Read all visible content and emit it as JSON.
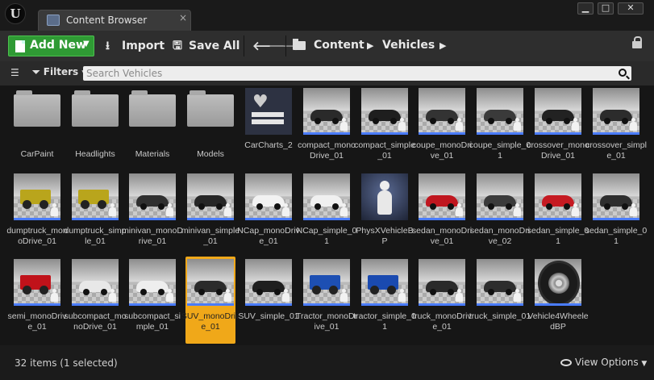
{
  "window": {
    "tab_title": "Content Browser",
    "tab_close": "×",
    "buttons": [
      "▁",
      "□",
      "✕"
    ]
  },
  "toolbar": {
    "add_new": "Add New",
    "import": "Import",
    "save_all": "Save All",
    "breadcrumb": [
      "Content",
      "Vehicles"
    ]
  },
  "search": {
    "filters": "Filters",
    "placeholder": "Search Vehicles"
  },
  "assets": [
    {
      "name": "CarPaint",
      "kind": "folder"
    },
    {
      "name": "Headlights",
      "kind": "folder"
    },
    {
      "name": "Materials",
      "kind": "folder"
    },
    {
      "name": "Models",
      "kind": "folder"
    },
    {
      "name": "CarCharts_2",
      "kind": "charts"
    },
    {
      "name": "compact_monoDrive_01",
      "kind": "car",
      "color": "#2a2a2a"
    },
    {
      "name": "compact_simple_01",
      "kind": "car",
      "color": "#1e1e1e"
    },
    {
      "name": "coupe_monoDrive_01",
      "kind": "car",
      "color": "#333333"
    },
    {
      "name": "coupe_simple_01",
      "kind": "car",
      "color": "#3a3a3a"
    },
    {
      "name": "crossover_monoDrive_01",
      "kind": "car",
      "color": "#222222"
    },
    {
      "name": "crossover_simple_01",
      "kind": "car",
      "color": "#2c2c2c"
    },
    {
      "name": "dumptruck_monoDrive_01",
      "kind": "truck",
      "color": "#b9a51c"
    },
    {
      "name": "dumptruck_simple_01",
      "kind": "truck",
      "color": "#b9a51c"
    },
    {
      "name": "minivan_monoDrive_01",
      "kind": "car",
      "color": "#303030"
    },
    {
      "name": "minivan_simple_01",
      "kind": "car",
      "color": "#262626"
    },
    {
      "name": "NCap_monoDrive_01",
      "kind": "car",
      "color": "#f2f2f2"
    },
    {
      "name": "NCap_simple_01",
      "kind": "car",
      "color": "#f0f0f0"
    },
    {
      "name": "PhysXVehicleBP",
      "kind": "physx"
    },
    {
      "name": "sedan_monoDrive_01",
      "kind": "car",
      "color": "#c0161f"
    },
    {
      "name": "sedan_monoDrive_02",
      "kind": "car",
      "color": "#3b3b3b"
    },
    {
      "name": "sedan_simple_01",
      "kind": "car",
      "color": "#c51a22"
    },
    {
      "name": "sedan_simple_01",
      "kind": "car",
      "color": "#2e2e2e"
    },
    {
      "name": "semi_monoDrive_01",
      "kind": "truck",
      "color": "#c0121a"
    },
    {
      "name": "subcompact_monoDrive_01",
      "kind": "car",
      "color": "#e8e8e8"
    },
    {
      "name": "subcompact_simple_01",
      "kind": "car",
      "color": "#eeeeee"
    },
    {
      "name": "SUV_monoDrive_01",
      "kind": "car",
      "color": "#2b2b2b",
      "selected": true
    },
    {
      "name": "SUV_simple_01",
      "kind": "car",
      "color": "#1f1f1f"
    },
    {
      "name": "Tractor_monoDrive_01",
      "kind": "truck",
      "color": "#1d4fb3"
    },
    {
      "name": "tractor_simple_01",
      "kind": "truck",
      "color": "#1a4ab0"
    },
    {
      "name": "truck_monoDrive_01",
      "kind": "car",
      "color": "#2a2a2a"
    },
    {
      "name": "truck_simple_01",
      "kind": "car",
      "color": "#2d2d2d"
    },
    {
      "name": "Vehicle4WheeledBP",
      "kind": "wheel"
    }
  ],
  "status": {
    "count": "32 items (1 selected)",
    "view_options": "View Options"
  }
}
